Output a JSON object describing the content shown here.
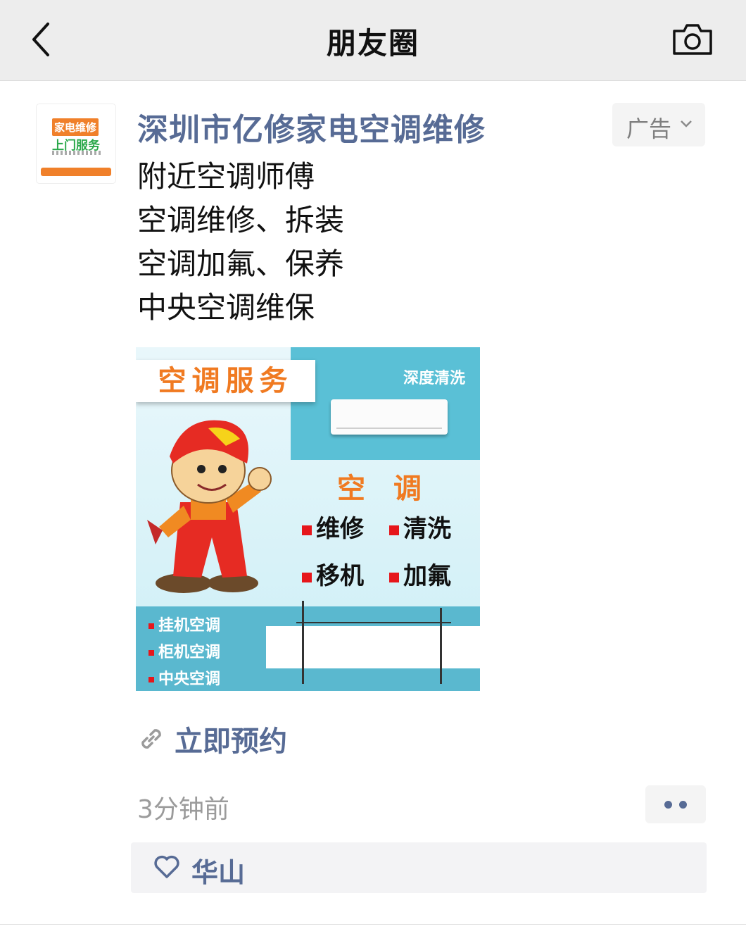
{
  "navbar": {
    "title": "朋友圈",
    "back_icon": "chevron-left-icon",
    "camera_icon": "camera-icon"
  },
  "post": {
    "avatar": {
      "line1": "家电维修",
      "line2": "上门服务"
    },
    "author": "深圳市亿修家电空调维修",
    "ad_label": "广告",
    "lines": [
      "附近空调师傅",
      "空调维修、拆装",
      "空调加氟、保养",
      "中央空调维保"
    ],
    "image": {
      "title": "空调服务",
      "deep_clean": "深度清洗",
      "heading": "空调",
      "services": [
        "维修",
        "清洗",
        "移机",
        "加氟"
      ],
      "types": [
        "挂机空调",
        "柜机空调",
        "中央空调"
      ]
    },
    "link_text": "立即预约",
    "time": "3分钟前",
    "likes": [
      "华山"
    ]
  },
  "colors": {
    "link_blue": "#576b95",
    "navbar_bg": "#ededed",
    "accent_orange": "#f07a21"
  }
}
